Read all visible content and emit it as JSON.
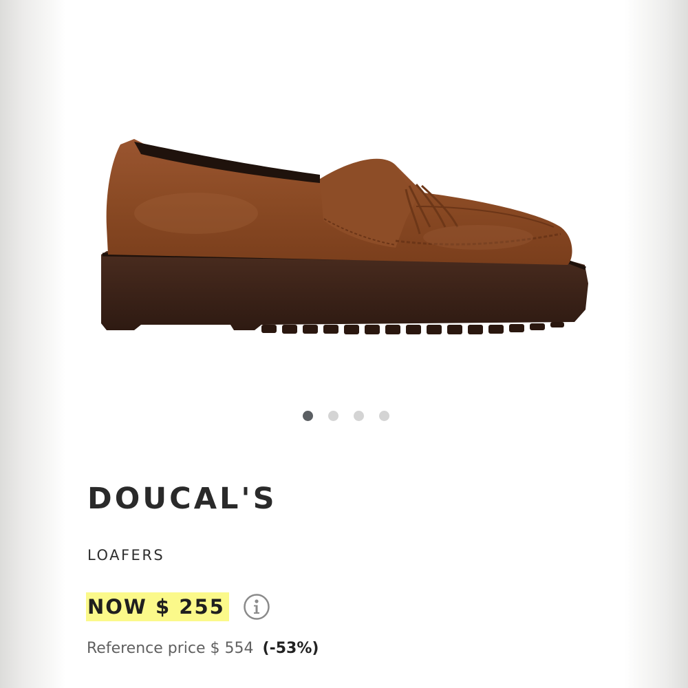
{
  "product": {
    "brand": "DOUCAL'S",
    "category": "LOAFERS",
    "price_now": "NOW $ 255",
    "reference_label": "Reference price",
    "reference_price": "$ 554",
    "discount": "(-53%)"
  },
  "gallery": {
    "image_subject": "brown suede tassel loafer with chunky lug sole",
    "total_images": 4,
    "active_index": 0
  },
  "icons": {
    "info": "info-icon"
  },
  "colors": {
    "price_highlight": "#fbf98a",
    "active_dot": "#5b5f63",
    "inactive_dot": "#d4d4d4",
    "suede": "#8a4a24",
    "sole": "#3a2218"
  }
}
